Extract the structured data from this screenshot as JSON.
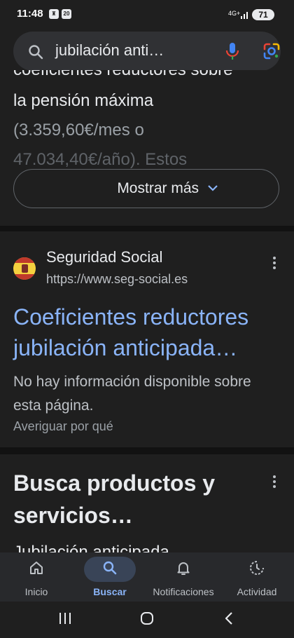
{
  "status_bar": {
    "time": "11:48",
    "notif_badge": "20",
    "network": "4G+",
    "battery": "71"
  },
  "search": {
    "query": "jubilación anti…"
  },
  "snippet": {
    "cut_line": "coeficientes reductores sobre",
    "line1": "la pensión máxima",
    "line2": "(3.359,60€/mes o",
    "line3": "47.034,40€/año). Estos",
    "more_button": "Mostrar más"
  },
  "result": {
    "site_name": "Seguridad Social",
    "url": "https://www.seg-social.es",
    "title": "Coeficientes reductores jubilación anticipada…",
    "description": "No hay información disponible sobre esta página.",
    "why_link": "Averiguar por qué"
  },
  "products": {
    "title": "Busca productos y servicios…",
    "cut_text": "Jubilación anticipada"
  },
  "bottom_nav": {
    "items": [
      {
        "label": "Inicio",
        "icon": "home-icon"
      },
      {
        "label": "Buscar",
        "icon": "search-icon"
      },
      {
        "label": "Notificaciones",
        "icon": "bell-icon"
      },
      {
        "label": "Actividad",
        "icon": "activity-icon"
      }
    ],
    "active_index": 1
  },
  "colors": {
    "background": "#1f1f1f",
    "link": "#8ab4f8",
    "active_pill": "#394457"
  }
}
